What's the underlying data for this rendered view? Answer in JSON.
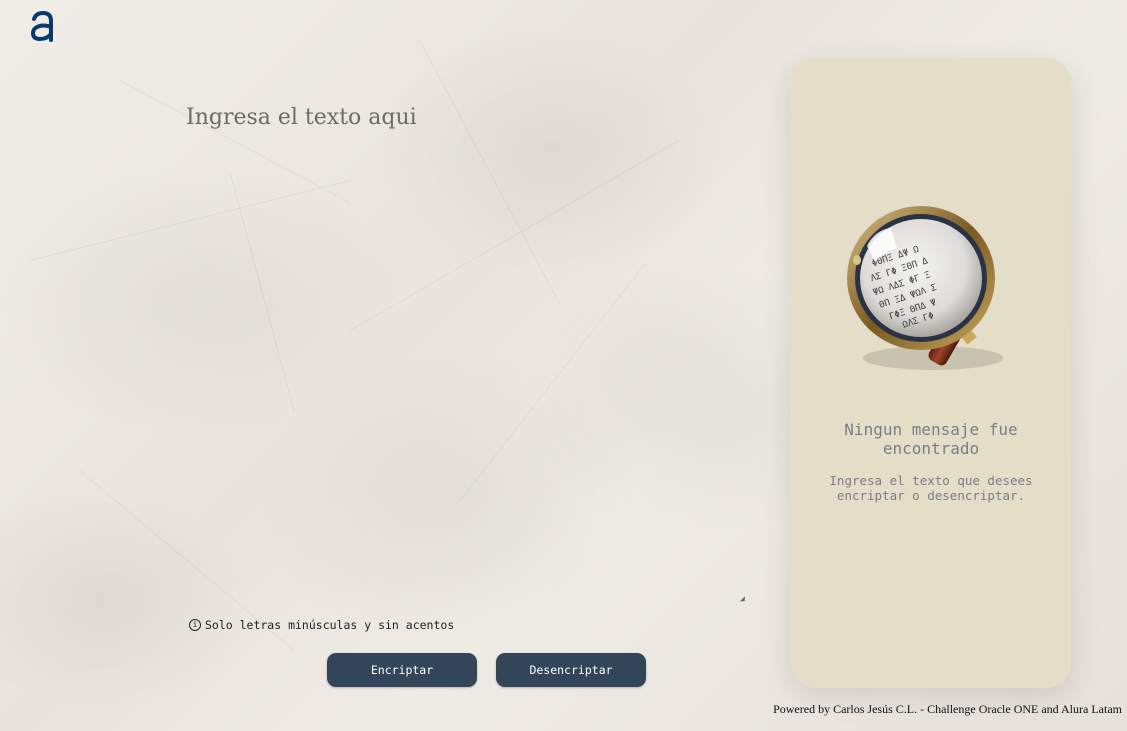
{
  "logo": {
    "letter": "a",
    "color": "#0a3871"
  },
  "input": {
    "placeholder": "Ingresa el texto aqui",
    "value": ""
  },
  "hint": {
    "icon": "info-icon",
    "text": "Solo letras minúsculas y sin acentos"
  },
  "buttons": {
    "encrypt": "Encriptar",
    "decrypt": "Desencriptar"
  },
  "output_panel": {
    "image": "magnifying-glass-over-cipher-text",
    "title": "Ningun mensaje fue encontrado",
    "subtitle": "Ingresa el texto que desees encriptar o desencriptar."
  },
  "footer": {
    "text": "Powered by Carlos Jesús C.L. - Challenge Oracle ONE and Alura Latam"
  },
  "colors": {
    "button": "#324559",
    "panel": "#e4dec8",
    "muted_text": "#7a7d86"
  }
}
